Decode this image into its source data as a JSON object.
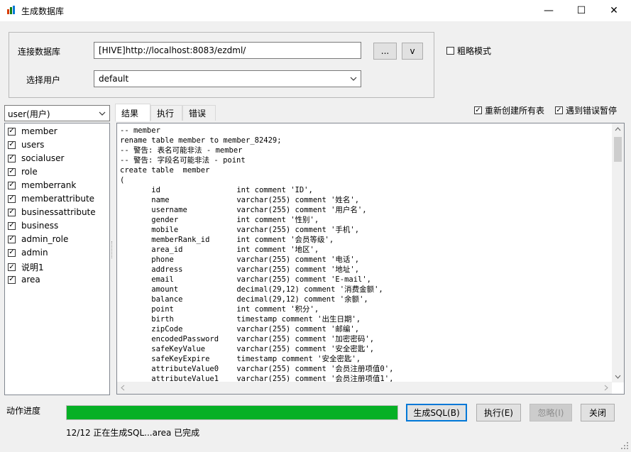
{
  "window": {
    "title": "生成数据库",
    "minimize": "—",
    "maximize": "☐",
    "close": "✕"
  },
  "connection": {
    "db_label": "连接数据库",
    "db_value": "[HIVE]http://localhost:8083/ezdml/",
    "browse_label": "...",
    "v_label": "v",
    "user_label": "选择用户",
    "user_value": "default"
  },
  "options": {
    "rough_mode": "粗略模式",
    "recreate_all": "重新创建所有表",
    "pause_on_error": "遇到错误暂停"
  },
  "user_select": "user(用户)",
  "tables": [
    "member",
    "users",
    "socialuser",
    "role",
    "memberrank",
    "memberattribute",
    "businessattribute",
    "business",
    "admin_role",
    "admin",
    "说明1",
    "area"
  ],
  "tabs": {
    "result": "结果",
    "execute": "执行",
    "error": "错误"
  },
  "sql_lines": [
    "-- member",
    "rename table member to member_82429;",
    "-- 警告: 表名可能非法 - member",
    "-- 警告: 字段名可能非法 - point",
    "create table  member",
    "(",
    "       id                 int comment 'ID',",
    "       name               varchar(255) comment '姓名',",
    "       username           varchar(255) comment '用户名',",
    "       gender             int comment '性别',",
    "       mobile             varchar(255) comment '手机',",
    "       memberRank_id      int comment '会员等级',",
    "       area_id            int comment '地区',",
    "       phone              varchar(255) comment '电话',",
    "       address            varchar(255) comment '地址',",
    "       email              varchar(255) comment 'E-mail',",
    "       amount             decimal(29,12) comment '消费金额',",
    "       balance            decimal(29,12) comment '余额',",
    "       point              int comment '积分',",
    "       birth              timestamp comment '出生日期',",
    "       zipCode            varchar(255) comment '邮编',",
    "       encodedPassword    varchar(255) comment '加密密码',",
    "       safeKeyValue       varchar(255) comment '安全密匙',",
    "       safeKeyExpire      timestamp comment '安全密匙',",
    "       attributeValue0    varchar(255) comment '会员注册项值0',",
    "       attributeValue1    varchar(255) comment '会员注册项值1',"
  ],
  "progress": {
    "label": "动作进度",
    "value": 1.0,
    "status": "12/12 正在生成SQL...area 已完成",
    "color": "#06b025"
  },
  "buttons": {
    "generate": "生成SQL(B)",
    "execute": "执行(E)",
    "ignore": "忽略(I)",
    "close": "关闭"
  }
}
